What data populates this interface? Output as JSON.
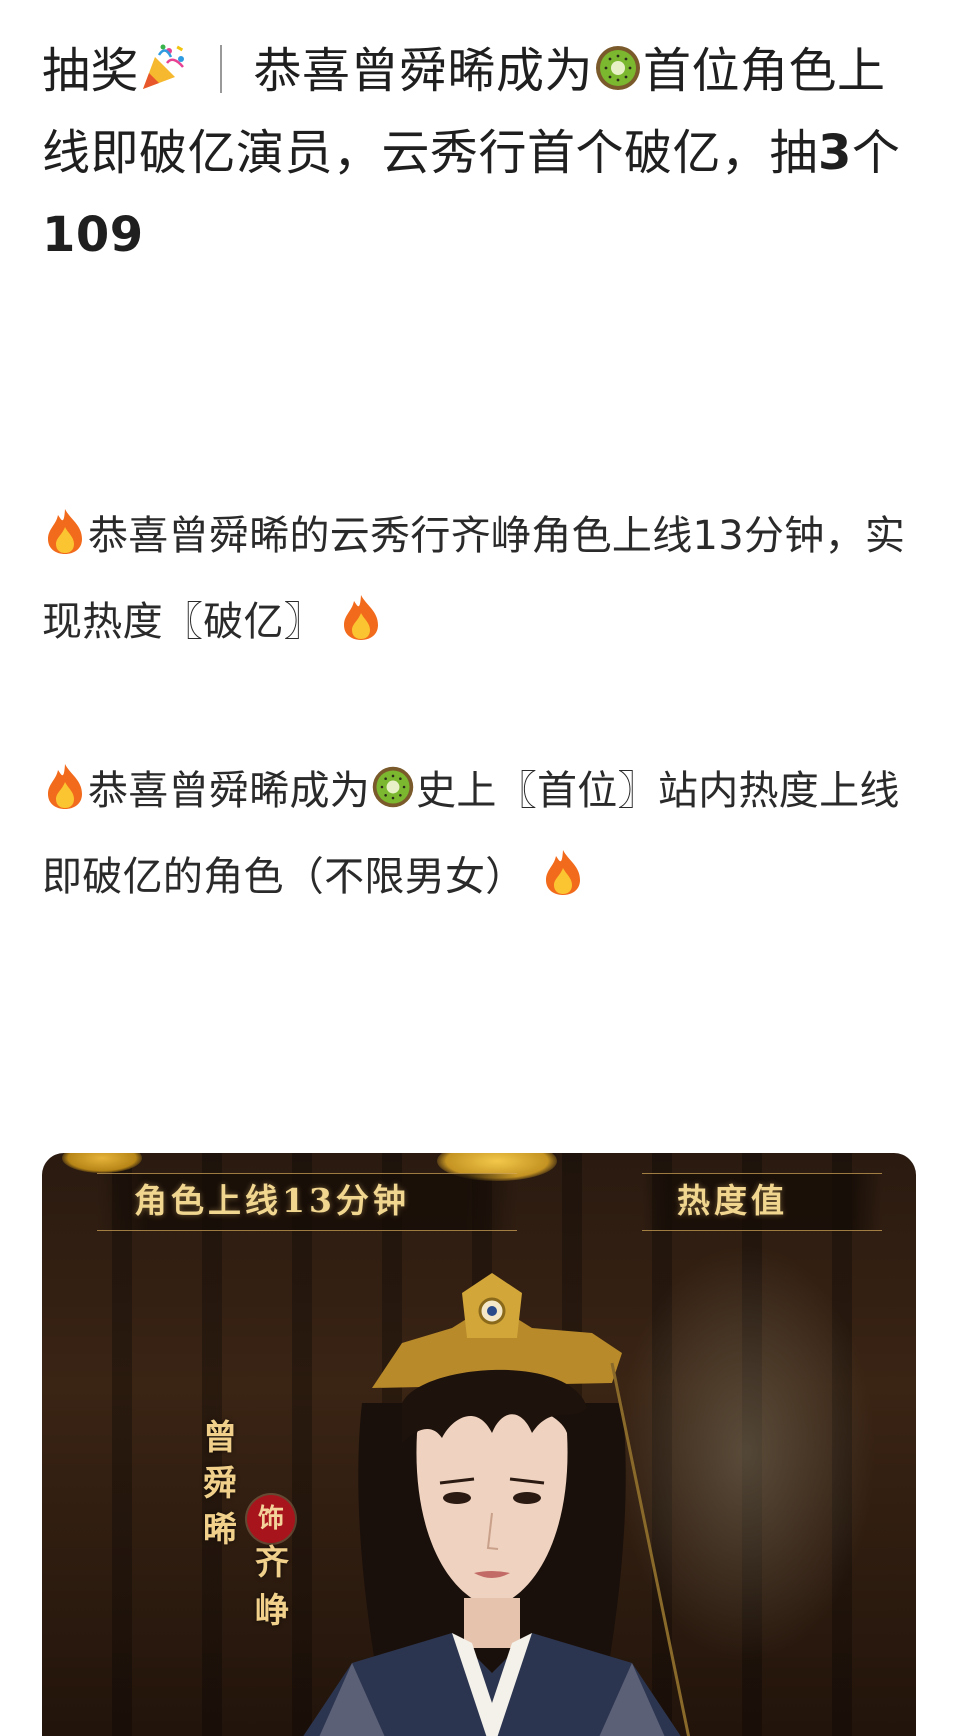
{
  "post": {
    "title_part1": "抽奖",
    "title_sep": "｜",
    "title_part2": "恭喜曾舜晞成为",
    "title_part3": "首位角色上线即破亿演员，云秀行首个破亿，抽",
    "title_num1": "3",
    "title_part4": "个",
    "title_num2": "109"
  },
  "paragraphs": {
    "p1_text_a": "恭喜曾舜晞的云秀行齐峥角色上线13分钟，实现热度〖破亿〗",
    "p2_text_a": "恭喜曾舜晞成为",
    "p2_text_b": "史上〖首位〗站内热度上线即破亿的角色（不限男女）"
  },
  "poster": {
    "label_left": "角色上线13分钟",
    "label_right": "热度值",
    "actor_name": "曾舜晞",
    "seal_char": "饰",
    "role_name": "齐峥"
  },
  "icons": {
    "party": "party-popper-icon",
    "kiwi": "kiwi-icon",
    "fire": "fire-icon"
  },
  "colors": {
    "poster_gold_text": "#f1d690",
    "seal_red": "#a8141c",
    "fire_orange": "#f26a1b",
    "kiwi_green": "#6aa02a"
  }
}
